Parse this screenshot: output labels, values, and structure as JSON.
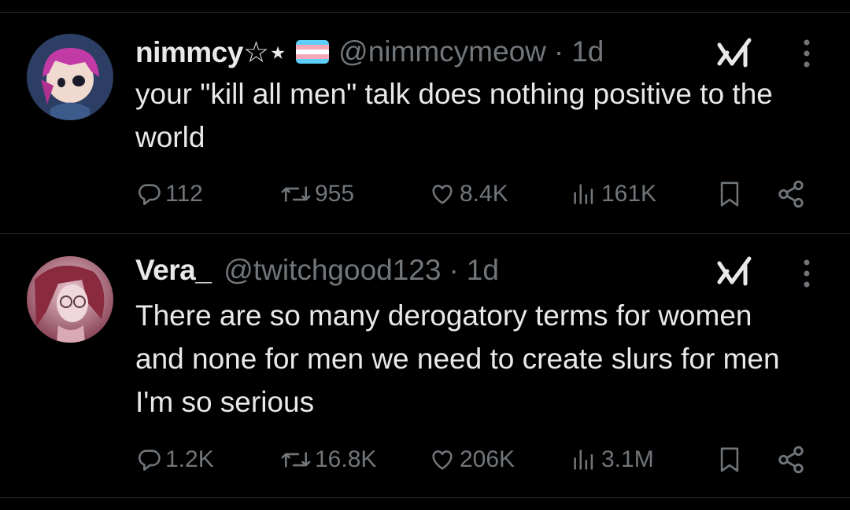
{
  "tweets": [
    {
      "display_name": "nimmcy☆⋆",
      "handle": "@nimmcymeow",
      "separator": "·",
      "time": "1d",
      "text": "your \"kill all men\" talk does nothing positive to the world",
      "stats": {
        "replies": "112",
        "reposts": "955",
        "likes": "8.4K",
        "views": "161K"
      },
      "has_flag": true,
      "avatar_colors": [
        "#3a4f7a",
        "#c23aa6"
      ]
    },
    {
      "display_name": "Vera_",
      "handle": "@twitchgood123",
      "separator": "·",
      "time": "1d",
      "text": "There are so many derogatory terms for women and none for men we need to create slurs for men I'm so serious",
      "stats": {
        "replies": "1.2K",
        "reposts": "16.8K",
        "likes": "206K",
        "views": "3.1M"
      },
      "has_flag": false,
      "avatar_colors": [
        "#6e2a3a",
        "#e3b8c2"
      ]
    }
  ],
  "colors": {
    "background": "#000000",
    "text": "#e7e9ea",
    "muted": "#71767b",
    "divider": "#2f3336"
  },
  "icons": [
    "reply-icon",
    "repost-icon",
    "like-icon",
    "views-icon",
    "bookmark-icon",
    "share-icon",
    "grok-icon",
    "more-icon"
  ]
}
